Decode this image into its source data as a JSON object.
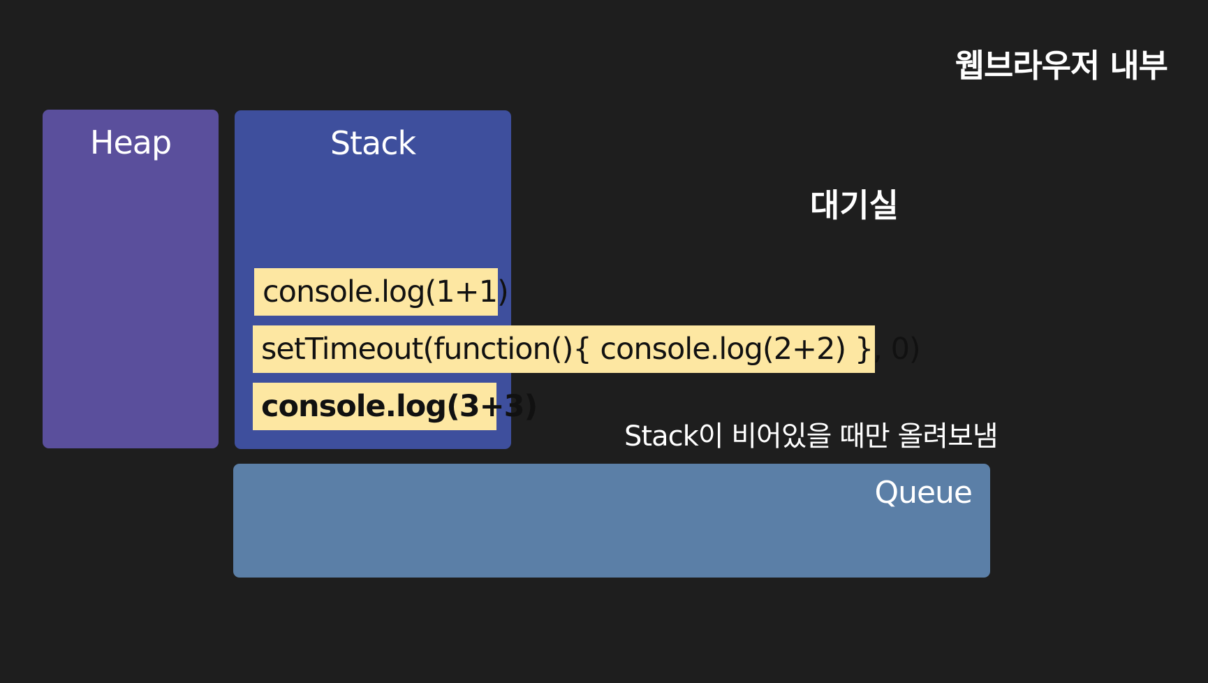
{
  "title": "웹브라우저 내부",
  "heap": {
    "label": "Heap"
  },
  "stack": {
    "label": "Stack",
    "items": [
      "console.log(1+1)",
      "setTimeout(function(){ console.log(2+2) }, 0)",
      "console.log(3+3)"
    ]
  },
  "waiting_room": {
    "label": "대기실"
  },
  "note": "Stack이 비어있을 때만 올려보냄",
  "queue": {
    "label": "Queue"
  },
  "colors": {
    "background": "#1e1e1e",
    "heap": "#5a4f9c",
    "stack": "#3e4f9d",
    "queue": "#5b7fa7",
    "code_chip": "#fde7a2"
  }
}
